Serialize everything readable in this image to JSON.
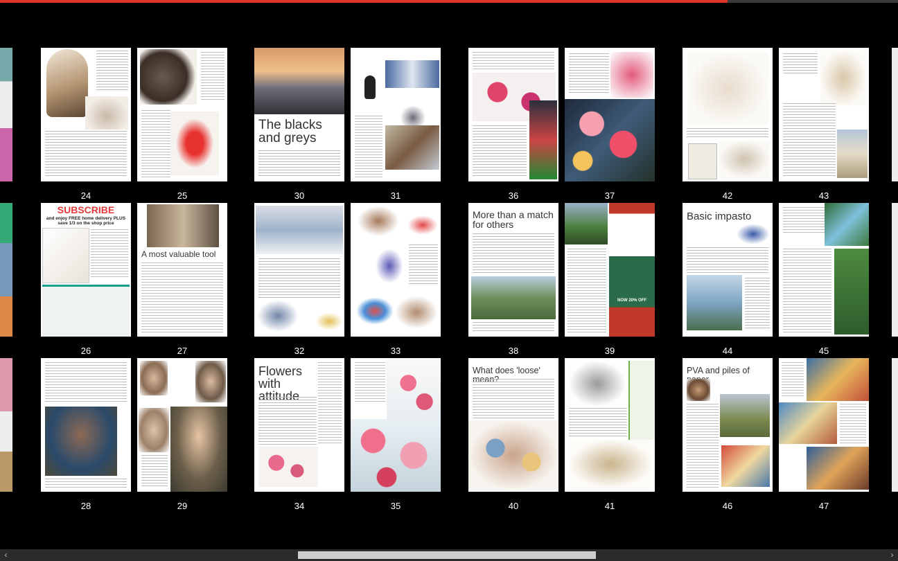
{
  "reading_progress_percent": 81,
  "spreads": [
    {
      "left_page": "24",
      "right_page": "25"
    },
    {
      "left_page": "30",
      "right_page": "31",
      "headline": "The blacks and greys"
    },
    {
      "left_page": "36",
      "right_page": "37"
    },
    {
      "left_page": "42",
      "right_page": "43"
    },
    {
      "left_page": "26",
      "right_page": "27",
      "subscribe": "SUBSCRIBE",
      "subscribe_offer": "and enjoy FREE home delivery PLUS save 1/3 on the shop price",
      "headline": "A most valuable tool"
    },
    {
      "left_page": "32",
      "right_page": "33"
    },
    {
      "left_page": "38",
      "right_page": "39",
      "headline": "More than a match for others",
      "ad_offer": "NOW 20% OFF"
    },
    {
      "left_page": "44",
      "right_page": "45",
      "headline": "Basic impasto"
    },
    {
      "left_page": "28",
      "right_page": "29"
    },
    {
      "left_page": "34",
      "right_page": "35",
      "headline": "Flowers with attitude"
    },
    {
      "left_page": "40",
      "right_page": "41",
      "headline": "What does 'loose' mean?"
    },
    {
      "left_page": "46",
      "right_page": "47",
      "headline": "PVA and piles of paper"
    }
  ],
  "scrollbar": {
    "left_arrow": "‹",
    "right_arrow": "›"
  }
}
